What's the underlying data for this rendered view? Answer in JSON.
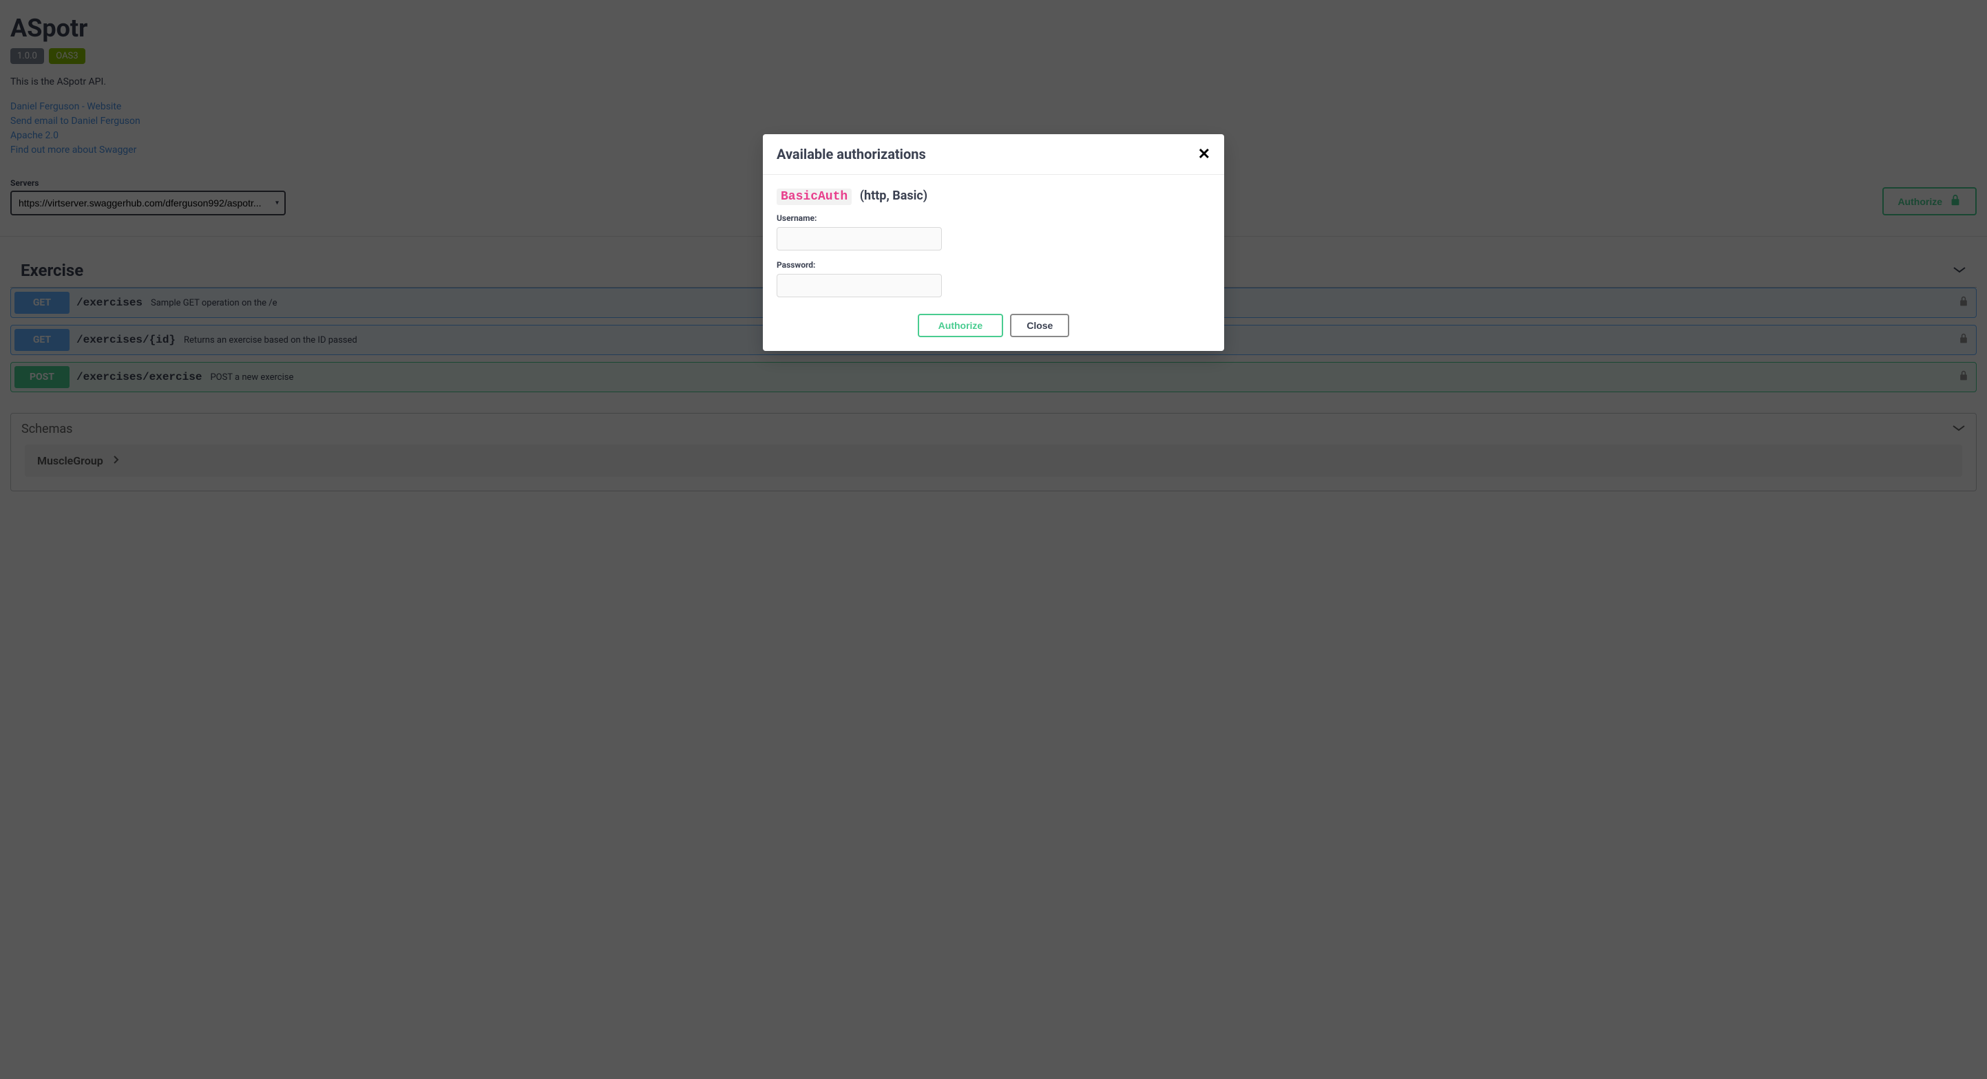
{
  "header": {
    "title": "ASpotr",
    "version_badge": "1.0.0",
    "oas_badge": "OAS3",
    "description": "This is the ASpotr API.",
    "links": {
      "website": "Daniel Ferguson - Website",
      "email": "Send email to Daniel Ferguson",
      "license": "Apache 2.0",
      "swagger_more": "Find out more about Swagger"
    }
  },
  "servers": {
    "label": "Servers",
    "selected": "https://virtserver.swaggerhub.com/dferguson992/aspotr..."
  },
  "authorize_button": "Authorize",
  "tags": {
    "exercise": {
      "name": "Exercise",
      "ops": [
        {
          "method": "GET",
          "path": "/exercises",
          "desc": "Sample GET operation on the /e"
        },
        {
          "method": "GET",
          "path": "/exercises/{id}",
          "desc": "Returns an exercise based on the ID passed"
        },
        {
          "method": "POST",
          "path": "/exercises/exercise",
          "desc": "POST a new exercise"
        }
      ]
    }
  },
  "schemas": {
    "title": "Schemas",
    "items": [
      "MuscleGroup"
    ]
  },
  "modal": {
    "title": "Available authorizations",
    "auth_name": "BasicAuth",
    "auth_type": "(http, Basic)",
    "username_label": "Username:",
    "password_label": "Password:",
    "authorize_label": "Authorize",
    "close_label": "Close"
  }
}
